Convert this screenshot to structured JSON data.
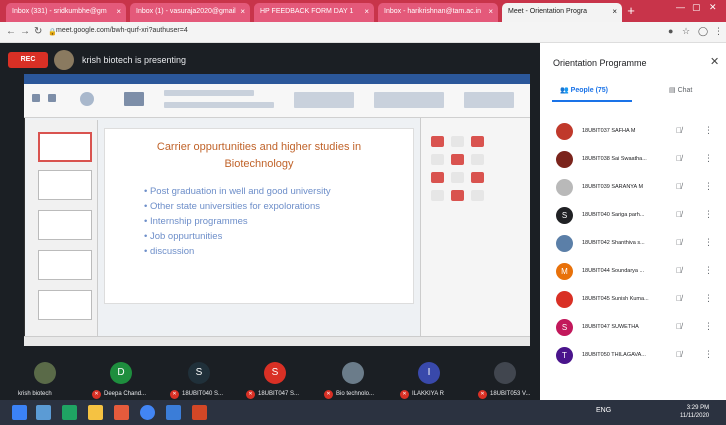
{
  "browser": {
    "tabs": [
      {
        "label": "Inbox (331) - sridkumbhe@gm",
        "active": false
      },
      {
        "label": "Inbox (1) - vasuraja2020@gmail",
        "active": false
      },
      {
        "label": "HP FEEDBACK FORM DAY 1",
        "active": false
      },
      {
        "label": "Inbox - harikrishnan@tam.ac.in",
        "active": false
      },
      {
        "label": "Meet - Orientation Progra",
        "active": true
      }
    ],
    "url": "meet.google.com/bwh-qurf-xri?authuser=4"
  },
  "meet": {
    "rec_label": "REC",
    "presenter_label": "krish biotech is presenting"
  },
  "slide": {
    "title_line1": "Carrier oppurtunities and higher studies in",
    "title_line2": "Biotechnology",
    "bullets": [
      "Post graduation in well and good university",
      "Other state universities for expolorations",
      "Internship programmes",
      "Job oppurtunities",
      "discussion"
    ]
  },
  "tiles": [
    {
      "initial": "",
      "name": "krish biotech",
      "color": "#5a6a48"
    },
    {
      "initial": "D",
      "name": "Deepa Chand...",
      "color": "#1e8e3e"
    },
    {
      "initial": "S",
      "name": "18UBIT040 S...",
      "color": "#20303a"
    },
    {
      "initial": "S",
      "name": "18UBIT047 S...",
      "color": "#d93025"
    },
    {
      "initial": "",
      "name": "Bio technolo...",
      "color": "#6b7c8a"
    },
    {
      "initial": "I",
      "name": "ILAKKIYA R",
      "color": "#3949ab"
    },
    {
      "initial": "",
      "name": "18UBIT053 V...",
      "color": "#41464f"
    }
  ],
  "panel": {
    "title": "Orientation Programme",
    "tab_people": "People (75)",
    "tab_chat": "Chat",
    "people": [
      {
        "initial": "",
        "name": "18UBIT037 SAFHA M",
        "color": "#c0392b"
      },
      {
        "initial": "",
        "name": "18UBIT038 Sai Swaatha...",
        "color": "#7b241c"
      },
      {
        "initial": "",
        "name": "18UBIT039 SARANYA M",
        "color": "#b9b9b9"
      },
      {
        "initial": "S",
        "name": "18UBIT040 Sariga parh...",
        "color": "#202124"
      },
      {
        "initial": "",
        "name": "18UBIT042 Shanthiva s...",
        "color": "#5b7fa8"
      },
      {
        "initial": "M",
        "name": "18UBIT044 Soundarya ...",
        "color": "#e8710a"
      },
      {
        "initial": "",
        "name": "18UBIT045 Sunish Kuma...",
        "color": "#d93025"
      },
      {
        "initial": "S",
        "name": "18UBIT047 SUWETHA",
        "color": "#c2185b"
      },
      {
        "initial": "T",
        "name": "18UBIT050 THILAGAVA...",
        "color": "#4a148c"
      }
    ]
  },
  "taskbar": {
    "clock_time": "3:29 PM",
    "clock_date": "11/11/2020",
    "lang": "ENG"
  }
}
